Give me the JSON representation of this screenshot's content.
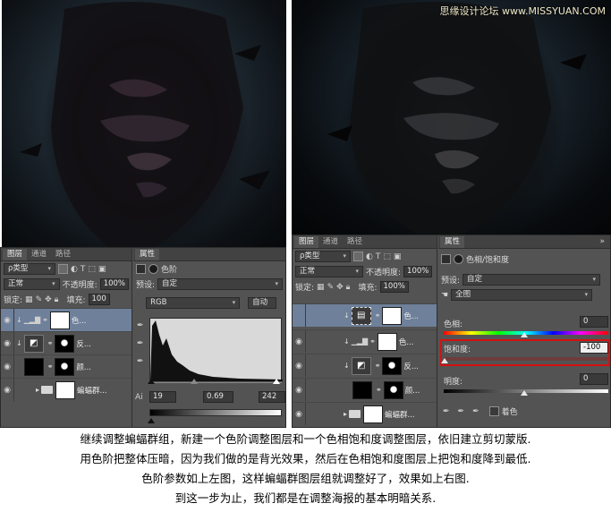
{
  "watermark": "思缘设计论坛 www.MISSYUAN.COM",
  "left_panel": {
    "tabs": [
      "图层",
      "通道",
      "路径"
    ],
    "kind_label": "ρ类型",
    "blend_mode": "正常",
    "opacity_label": "不透明度:",
    "opacity_value": "100%",
    "lock_label": "锁定:",
    "fill_label": "填充:",
    "fill_value": "100",
    "layers": [
      {
        "name": "色...",
        "selected": true
      },
      {
        "name": "反..."
      },
      {
        "name": "颜..."
      },
      {
        "name": "蝙蝠群..."
      }
    ],
    "props_tab": "属性",
    "props_title": "色阶",
    "preset_label": "预设:",
    "preset_value": "自定",
    "channel_value": "RGB",
    "auto_button": "自动",
    "input_black": "19",
    "input_gamma": "0.69",
    "input_white": "242",
    "output_label": "Ai"
  },
  "right_panel": {
    "tabs": [
      "图层",
      "通道",
      "路径"
    ],
    "kind_label": "ρ类型",
    "blend_mode": "正常",
    "opacity_label": "不透明度:",
    "opacity_value": "100%",
    "lock_label": "锁定:",
    "fill_label": "填充:",
    "fill_value": "100%",
    "layers": [
      {
        "name": "色...",
        "selected": true
      },
      {
        "name": "色..."
      },
      {
        "name": "反..."
      },
      {
        "name": "颜..."
      },
      {
        "name": "蝙蝠群..."
      }
    ],
    "props_tab": "属性",
    "props_title": "色相/饱和度",
    "preset_label": "预设:",
    "preset_value": "自定",
    "range_value": "全图",
    "hue_label": "色相:",
    "hue_value": "0",
    "saturation_label": "饱和度:",
    "saturation_value": "-100",
    "lightness_label": "明度:",
    "lightness_value": "0",
    "colorize_label": "着色"
  },
  "caption": [
    "继续调整蝙蝠群组，新建一个色阶调整图层和一个色相饱和度调整图层，依旧建立剪切蒙版.",
    "用色阶把整体压暗，因为我们做的是背光效果，然后在色相饱和度图层上把饱和度降到最低.",
    "色阶参数如上左图，这样蝙蝠群图层组就调整好了，效果如上右图.",
    "到这一步为止，我们都是在调整海报的基本明暗关系."
  ],
  "colors": {
    "panel": "#535353",
    "selected_layer": "#6e809a",
    "highlight": "#d51010"
  }
}
